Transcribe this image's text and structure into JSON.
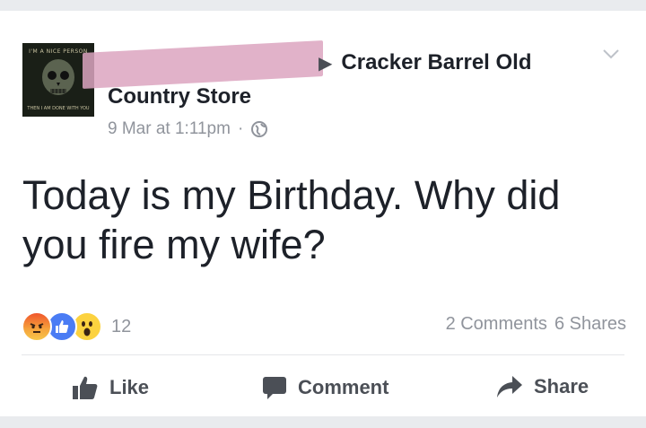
{
  "post": {
    "avatar": {
      "top_text": "I'M A NICE PERSON",
      "bottom_text": "THEN I AM DONE WITH YOU"
    },
    "header": {
      "arrow": "▶",
      "page_name_line1": "Cracker Barrel Old",
      "page_name_line2": "Country Store"
    },
    "meta": {
      "timestamp": "9 Mar at 1:11pm",
      "separator": "·",
      "privacy_icon": "globe-icon"
    },
    "body_text": "Today is my Birthday. Why did you fire my wife?",
    "reactions": {
      "types": [
        "angry",
        "like",
        "wow"
      ],
      "count": "12"
    },
    "stats": {
      "comments": "2 Comments",
      "shares": "6 Shares"
    },
    "actions": {
      "like": "Like",
      "comment": "Comment",
      "share": "Share"
    }
  },
  "colors": {
    "text": "#1d2129",
    "secondary": "#90949c",
    "action": "#4b4f56",
    "redaction": "#dca5c0",
    "like_blue": "#4a7cf4",
    "angry_orange": "#f0562c",
    "wow_yellow": "#fcd23f"
  }
}
